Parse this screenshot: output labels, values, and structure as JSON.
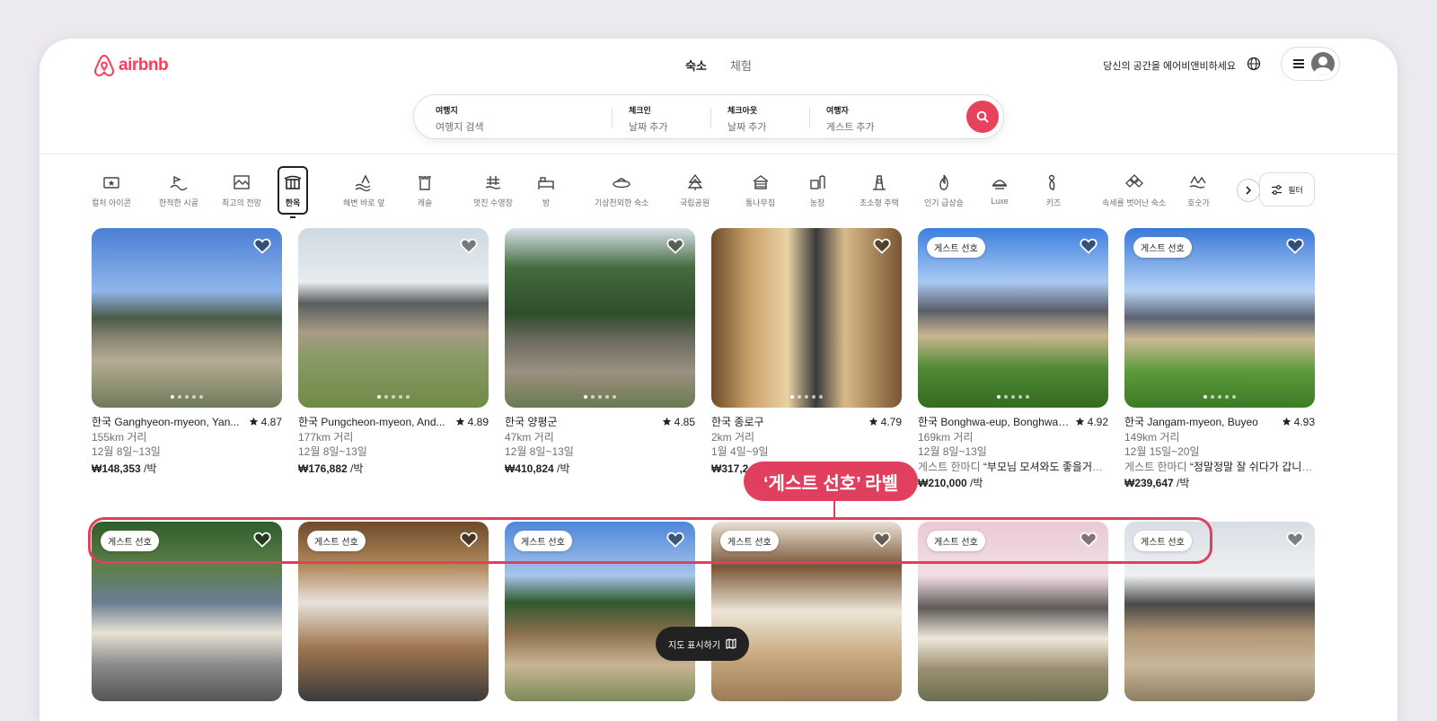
{
  "header": {
    "logo_text": "airbnb",
    "tabs": [
      {
        "label": "숙소",
        "active": true
      },
      {
        "label": "체험",
        "active": false
      }
    ],
    "host_link": "당신의 공간을 에어비앤비하세요"
  },
  "search": {
    "fields": [
      {
        "label": "여행지",
        "placeholder": "여행지 검색"
      },
      {
        "label": "체크인",
        "placeholder": "날짜 추가"
      },
      {
        "label": "체크아웃",
        "placeholder": "날짜 추가"
      },
      {
        "label": "여행자",
        "placeholder": "게스트 추가"
      }
    ]
  },
  "categories": [
    {
      "label": "컬처 아이콘",
      "icon": "ticket-star-icon"
    },
    {
      "label": "한적한 시골",
      "icon": "countryside-icon"
    },
    {
      "label": "최고의 전망",
      "icon": "view-icon"
    },
    {
      "label": "한옥",
      "icon": "hanok-icon",
      "selected": true
    },
    {
      "label": "해변 바로 앞",
      "icon": "beachfront-icon"
    },
    {
      "label": "캐슬",
      "icon": "castle-icon"
    },
    {
      "label": "멋진 수영장",
      "icon": "pool-icon"
    },
    {
      "label": "방",
      "icon": "bed-icon"
    },
    {
      "label": "기상천외한 숙소",
      "icon": "ufo-icon"
    },
    {
      "label": "국립공원",
      "icon": "park-icon"
    },
    {
      "label": "통나무집",
      "icon": "cabin-icon"
    },
    {
      "label": "농장",
      "icon": "farm-icon"
    },
    {
      "label": "초소형 주택",
      "icon": "tiny-home-icon"
    },
    {
      "label": "인기 급상승",
      "icon": "fire-icon"
    },
    {
      "label": "Luxe",
      "icon": "luxe-icon"
    },
    {
      "label": "키즈",
      "icon": "kids-icon"
    },
    {
      "label": "속세를 벗어난 숙소",
      "icon": "offgrid-icon"
    },
    {
      "label": "호숫가",
      "icon": "lake-icon"
    }
  ],
  "filter_label": "필터",
  "listings_row1": [
    {
      "title": "한국 Ganghyeon-myeon, Yan...",
      "rating": "4.87",
      "distance": "155km 거리",
      "dates": "12월 8일~13일",
      "price": "₩148,353",
      "unit": " /박",
      "badge": "",
      "review": ""
    },
    {
      "title": "한국 Pungcheon-myeon, And...",
      "rating": "4.89",
      "distance": "177km 거리",
      "dates": "12월 8일~13일",
      "price": "₩176,882",
      "unit": " /박",
      "badge": "",
      "review": ""
    },
    {
      "title": "한국 양평군",
      "rating": "4.85",
      "distance": "47km 거리",
      "dates": "12월 8일~13일",
      "price": "₩410,824",
      "unit": " /박",
      "badge": "",
      "review": ""
    },
    {
      "title": "한국 종로구",
      "rating": "4.79",
      "distance": "2km 거리",
      "dates": "1월 4일~9일",
      "price": "₩317,2",
      "unit": "",
      "badge": "",
      "review": ""
    },
    {
      "title": "한국 Bonghwa-eup, Bonghwa-...",
      "rating": "4.92",
      "distance": "169km 거리",
      "dates": "12월 8일~13일",
      "price": "₩210,000",
      "unit": " /박",
      "badge": "게스트 선호",
      "review_label": "게스트 한마디",
      "review": "“부모님 모셔와도 좋을거같...”"
    },
    {
      "title": "한국 Jangam-myeon, Buyeo",
      "rating": "4.93",
      "distance": "149km 거리",
      "dates": "12월 15일~20일",
      "price": "₩239,647",
      "unit": " /박",
      "badge": "게스트 선호",
      "review_label": "게스트 한마디",
      "review": "“정말정말 잘 쉬다가 갑니다”"
    }
  ],
  "listings_row2": [
    {
      "badge": "게스트 선호"
    },
    {
      "badge": "게스트 선호"
    },
    {
      "badge": "게스트 선호"
    },
    {
      "badge": "게스트 선호"
    },
    {
      "badge": "게스트 선호"
    },
    {
      "badge": "게스트 선호"
    }
  ],
  "annotation": {
    "callout": "‘게스트 선호’ 라벨"
  },
  "map_button": "지도 표시하기",
  "colors": {
    "brand": "#ff385c",
    "highlight": "#e0405e"
  }
}
